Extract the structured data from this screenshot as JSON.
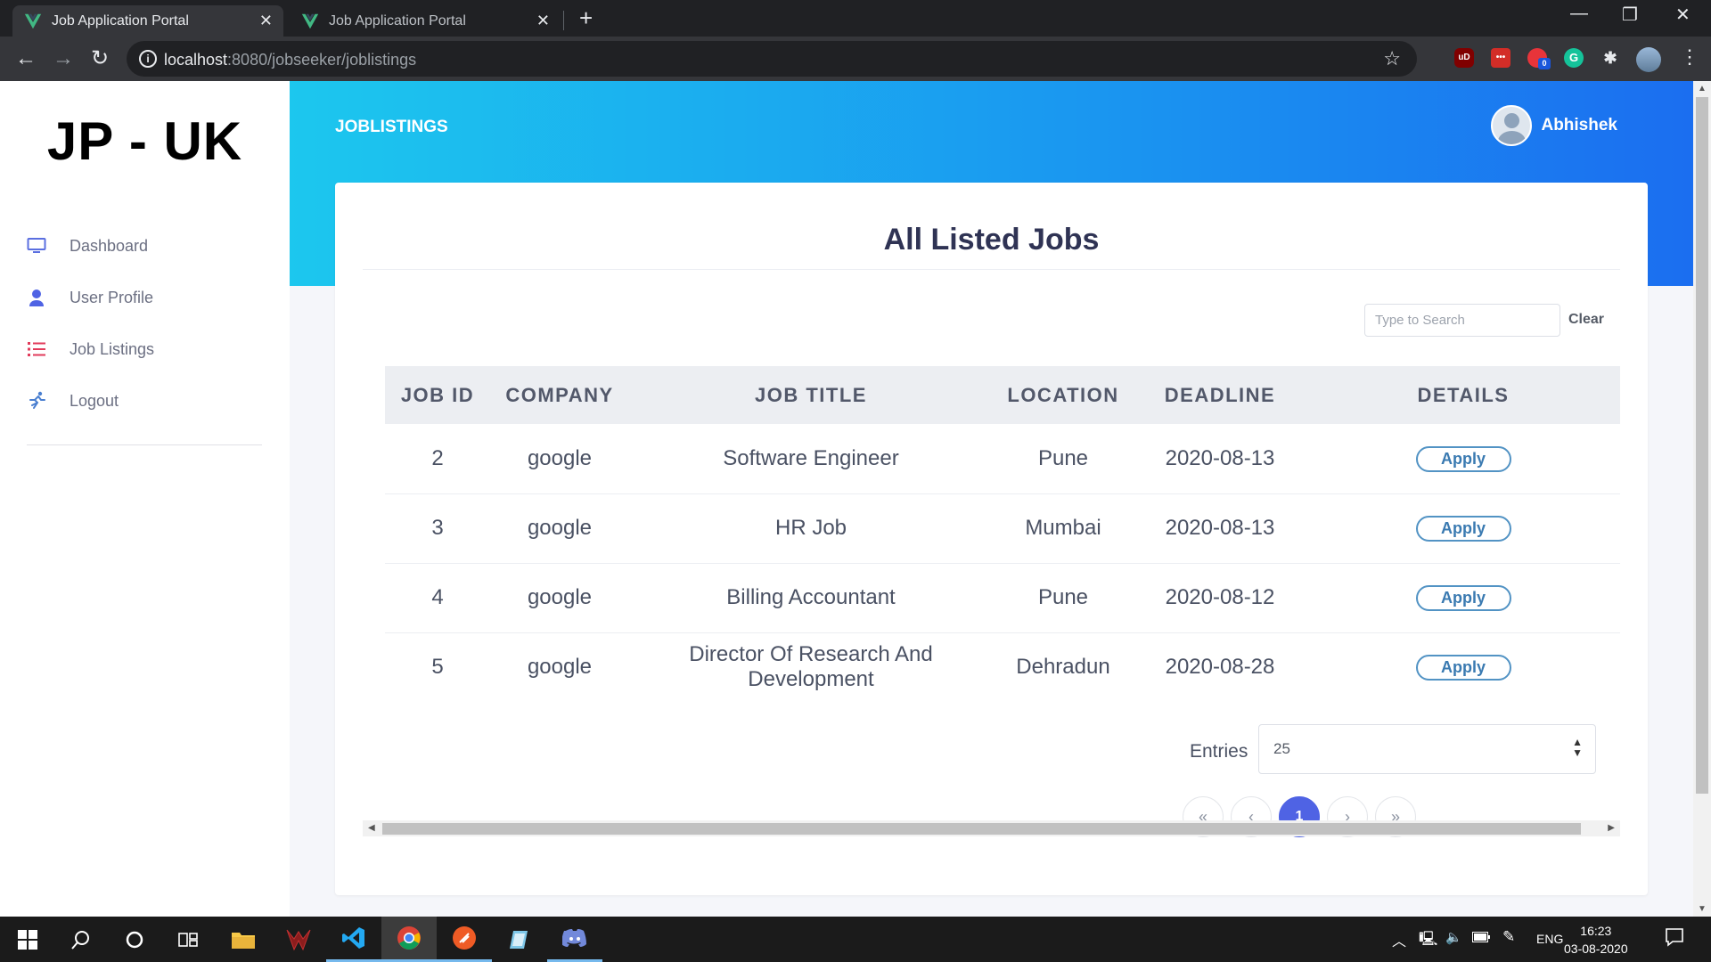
{
  "browser": {
    "tabs": [
      {
        "title": "Job Application Portal",
        "active": true
      },
      {
        "title": "Job Application Portal",
        "active": false
      }
    ],
    "url_host": "localhost",
    "url_path": ":8080/jobseeker/joblistings",
    "extensions": [
      "ublock-icon",
      "lastpass-icon",
      "adblock-icon",
      "grammarly-icon",
      "puzzle-extensions-icon"
    ],
    "adblock_badge": "0",
    "ublock_label": "uD"
  },
  "sidebar": {
    "brand": "JP - UK",
    "items": [
      {
        "label": "Dashboard",
        "icon": "monitor-icon"
      },
      {
        "label": "User Profile",
        "icon": "user-icon"
      },
      {
        "label": "Job Listings",
        "icon": "list-icon"
      },
      {
        "label": "Logout",
        "icon": "running-person-icon"
      }
    ]
  },
  "header": {
    "title": "JOBLISTINGS",
    "user_name": "Abhishek"
  },
  "card": {
    "title": "All Listed Jobs",
    "search_placeholder": "Type to Search",
    "clear_label": "Clear",
    "columns": [
      "JOB ID",
      "COMPANY",
      "JOB TITLE",
      "LOCATION",
      "DEADLINE",
      "DETAILS"
    ],
    "rows": [
      {
        "id": "2",
        "company": "google",
        "title": "Software Engineer",
        "location": "Pune",
        "deadline": "2020-08-13",
        "action": "Apply"
      },
      {
        "id": "3",
        "company": "google",
        "title": "HR Job",
        "location": "Mumbai",
        "deadline": "2020-08-13",
        "action": "Apply"
      },
      {
        "id": "4",
        "company": "google",
        "title": "Billing Accountant",
        "location": "Pune",
        "deadline": "2020-08-12",
        "action": "Apply"
      },
      {
        "id": "5",
        "company": "google",
        "title": "Director Of Research And Development",
        "location": "Dehradun",
        "deadline": "2020-08-28",
        "action": "Apply"
      }
    ],
    "entries_label": "Entries",
    "entries_value": "25",
    "pagination": {
      "first": "«",
      "prev": "‹",
      "current": "1",
      "next": "›",
      "last": "»"
    }
  },
  "taskbar": {
    "language": "ENG",
    "time": "16:23",
    "date": "03-08-2020"
  },
  "colors": {
    "header_gradient_start": "#1cc7ee",
    "header_gradient_end": "#1b6ef0",
    "accent_page": "#4f63e4",
    "apply_border": "#5293c4"
  }
}
